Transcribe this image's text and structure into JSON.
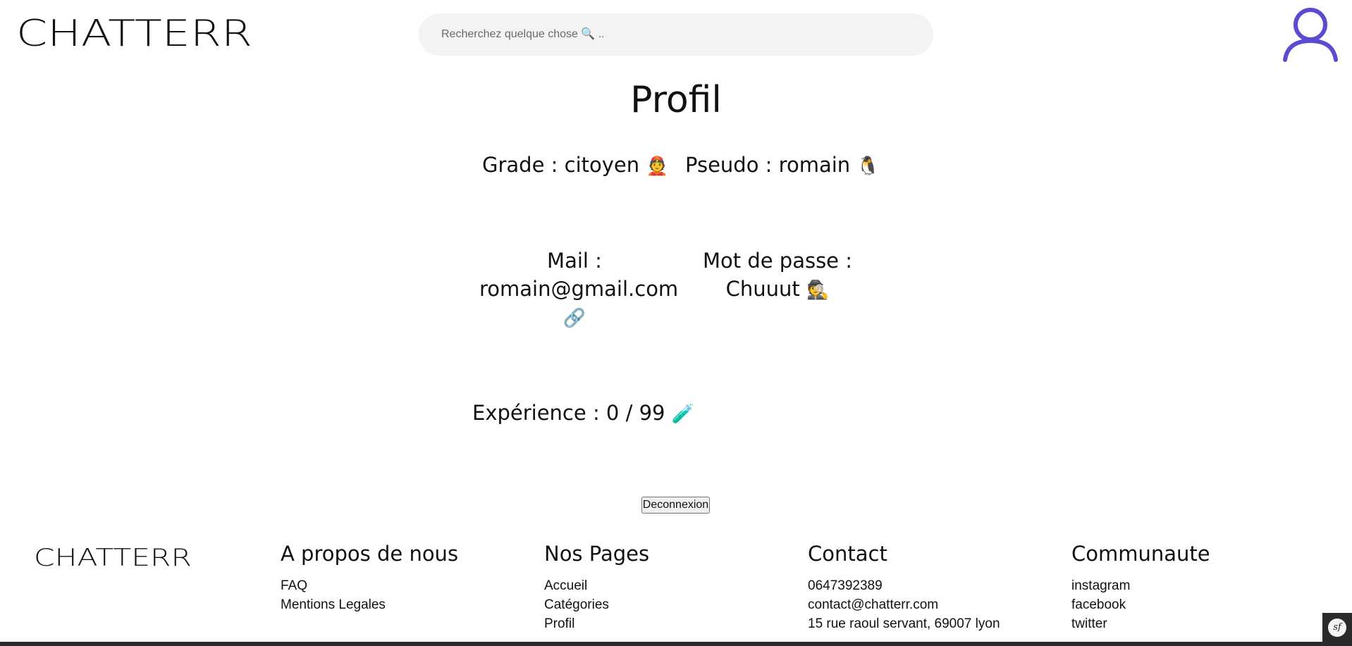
{
  "header": {
    "logo_text": "CHATTERR",
    "search_placeholder": "Recherchez quelque chose 🔍 ..",
    "accent_color": "#5a4bd1"
  },
  "profile": {
    "title": "Profil",
    "grade_label": "Grade : citoyen",
    "grade_emoji": "👲",
    "pseudo_label": "Pseudo : romain",
    "pseudo_emoji": "🐧",
    "mail_label": "Mail :",
    "mail_value": "romain@gmail.com",
    "mail_emoji": "🔗",
    "password_label": "Mot de passe :",
    "password_value": "Chuuut",
    "password_emoji": "🕵️",
    "experience_label": "Expérience : 0 / 99",
    "experience_emoji": "🧪",
    "logout_label": "Deconnexion"
  },
  "footer": {
    "logo_text": "CHATTERR",
    "about": {
      "title": "A propos de nous",
      "links": [
        "FAQ",
        "Mentions Legales"
      ]
    },
    "pages": {
      "title": "Nos Pages",
      "links": [
        "Accueil",
        "Catégories",
        "Profil"
      ]
    },
    "contact": {
      "title": "Contact",
      "lines": [
        "0647392389",
        "contact@chatterr.com",
        "15 rue raoul servant, 69007 lyon"
      ]
    },
    "community": {
      "title": "Communaute",
      "links": [
        "instagram",
        "facebook",
        "twitter"
      ]
    },
    "sf_badge": "sf"
  }
}
